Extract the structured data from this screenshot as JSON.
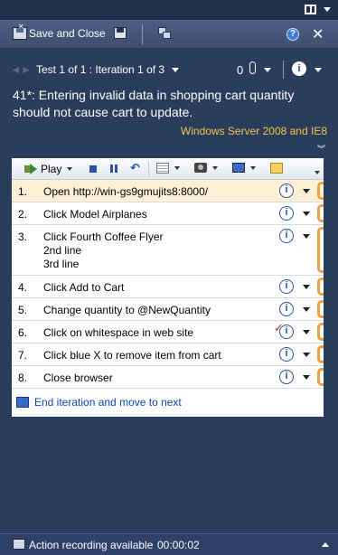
{
  "toolbar": {
    "save_close_label": "Save and Close",
    "help_glyph": "?",
    "close_glyph": "✕"
  },
  "nav": {
    "test_label": "Test 1 of 1 : Iteration 1 of 3",
    "attachment_count": "0",
    "info_glyph": "i"
  },
  "test": {
    "title": "41*: Entering invalid data in shopping cart quantity should not cause cart to update.",
    "configuration": "Windows Server 2008 and IE8"
  },
  "steps_toolbar": {
    "play_label": "Play"
  },
  "steps": [
    {
      "num": "1.",
      "text": "Open http://win-gs9gmujits8:8000/",
      "status": "info",
      "active": true
    },
    {
      "num": "2.",
      "text": "Click Model Airplanes",
      "status": "info"
    },
    {
      "num": "3.",
      "text": "Click Fourth Coffee Flyer\n2nd line\n3rd line",
      "status": "info"
    },
    {
      "num": "4.",
      "text": "Click Add to Cart",
      "status": "info"
    },
    {
      "num": "5.",
      "text": "Change quantity to @NewQuantity",
      "status": "info"
    },
    {
      "num": "6.",
      "text": "Click on whitespace in web site",
      "status": "fail"
    },
    {
      "num": "7.",
      "text": "Click blue X to remove item from cart",
      "status": "info"
    },
    {
      "num": "8.",
      "text": "Close browser",
      "status": "info"
    }
  ],
  "end_iteration_label": "End iteration and move to next",
  "status": {
    "recording_text": "Action recording available",
    "recording_time": "00:00:02"
  },
  "colors": {
    "background": "#2a3c5c",
    "config_text": "#f0c84a",
    "active_step": "#fdf0d4",
    "step_marker": "#f0a040",
    "link": "#0a4ab8"
  }
}
